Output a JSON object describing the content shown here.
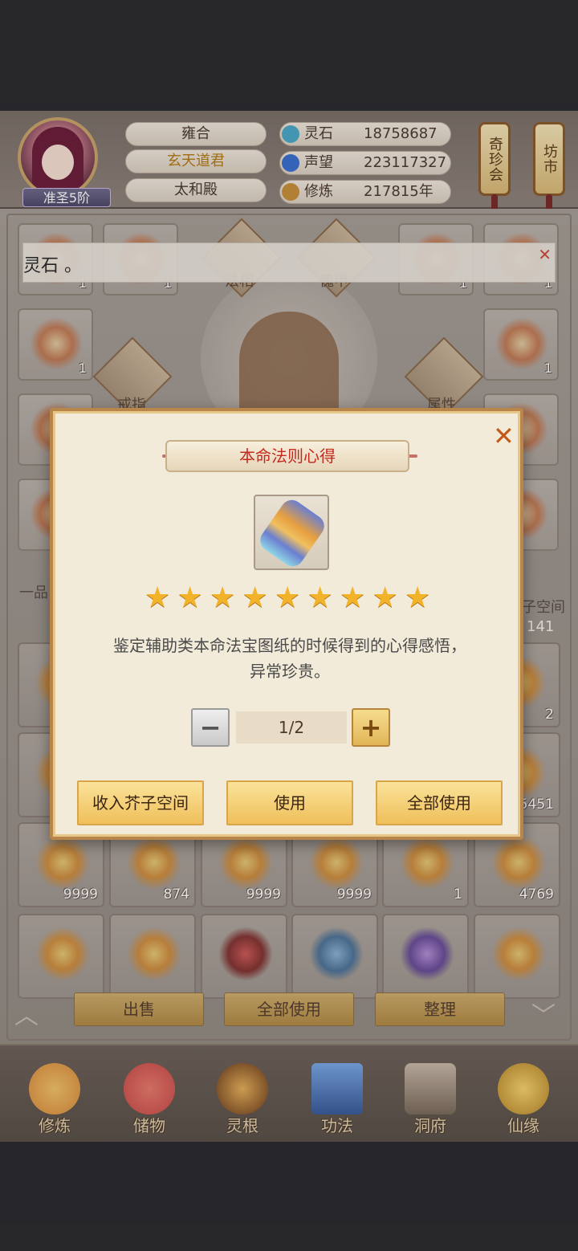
{
  "header": {
    "realm": "准圣5阶",
    "info": [
      "雍合",
      "玄天道君",
      "太和殿"
    ],
    "resources": [
      {
        "label": "灵石",
        "value": "18758687",
        "icon": "spirit-stone-icon",
        "color": "#4aa8c8"
      },
      {
        "label": "声望",
        "value": "223117327",
        "icon": "prestige-icon",
        "color": "#3a6fd0"
      },
      {
        "label": "修炼",
        "value": "217815年",
        "icon": "cultivation-icon",
        "color": "#c9903a"
      }
    ],
    "side_buttons": [
      "奇珍会",
      "坊市"
    ]
  },
  "toast": {
    "text": "灵石 。",
    "close": "✕"
  },
  "equipment": {
    "slots": [
      "法相",
      "傀甲",
      "戒指",
      "属性"
    ],
    "left_counts": [
      "1",
      "1",
      "1"
    ],
    "right_counts": [
      "1",
      "1",
      "1"
    ],
    "side_tab_left": "一品",
    "side_tab_right": "子空间",
    "space_count": "141"
  },
  "bag": {
    "row1_counts": [
      "9999",
      "874",
      "9999",
      "9999",
      "1",
      "4769"
    ],
    "side_counts": [
      "2",
      "5451"
    ]
  },
  "actions": {
    "sell": "出售",
    "use_all": "全部使用",
    "sort": "整理",
    "up": "︿",
    "down": "﹀"
  },
  "nav": [
    {
      "label": "修炼",
      "icon": "cultivate-icon",
      "color": "#d98a3a"
    },
    {
      "label": "储物",
      "icon": "storage-bag-icon",
      "color": "#c94a4a"
    },
    {
      "label": "灵根",
      "icon": "spirit-root-icon",
      "color": "#b87a2a"
    },
    {
      "label": "功法",
      "icon": "technique-book-icon",
      "color": "#4a7ab8"
    },
    {
      "label": "洞府",
      "icon": "cave-house-icon",
      "color": "#7a8a9a"
    },
    {
      "label": "仙缘",
      "icon": "gourd-icon",
      "color": "#d9a83a"
    }
  ],
  "modal": {
    "title": "本命法则心得",
    "star_count": 9,
    "star_glyph": "★",
    "description_line1": "鉴定辅助类本命法宝图纸的时候得到的心得感悟，",
    "description_line2": "异常珍贵。",
    "quantity": "1/2",
    "minus": "−",
    "plus": "+",
    "close": "✕",
    "buttons": {
      "store": "收入芥子空间",
      "use": "使用",
      "use_all": "全部使用"
    }
  }
}
